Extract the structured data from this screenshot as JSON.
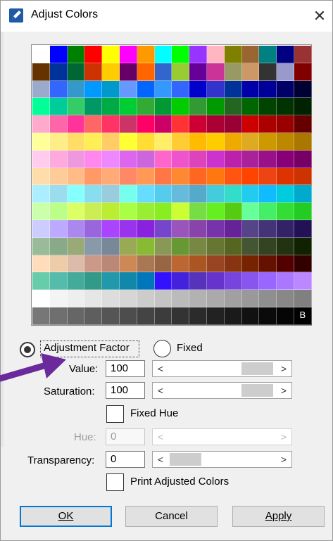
{
  "window": {
    "title": "Adjust Colors",
    "close_glyph": "✕",
    "title_icon": "pencil-icon"
  },
  "palette": {
    "rows": [
      [
        "#ffffff",
        "#0000ff",
        "#008000",
        "#ff0000",
        "#ffff00",
        "#ff00ff",
        "#ff9900",
        "#00ffff",
        "#00ff00",
        "#9933ff",
        "#ffb6c1",
        "#808000",
        "#996633",
        "#008080",
        "#000080",
        "#993333"
      ],
      [
        "#663300",
        "#003399",
        "#006633",
        "#cc3300",
        "#ffcc00",
        "#660066",
        "#ff6600",
        "#3366cc",
        "#99cc33",
        "#660099",
        "#cc3399",
        "#999966",
        "#cc9966",
        "#333333",
        "#9999cc",
        "#800000"
      ],
      [
        "#99aacc",
        "#3366ff",
        "#3399cc",
        "#0099ff",
        "#0099cc",
        "#6699ff",
        "#0066ff",
        "#3399ff",
        "#3366ff",
        "#0000cc",
        "#3333cc",
        "#003399",
        "#0000aa",
        "#000099",
        "#000066",
        "#000033"
      ],
      [
        "#00ff99",
        "#00cc99",
        "#33cc66",
        "#009966",
        "#00aa44",
        "#00cc33",
        "#33aa33",
        "#009933",
        "#00cc00",
        "#339933",
        "#009900",
        "#226622",
        "#006600",
        "#004400",
        "#003300",
        "#002200"
      ],
      [
        "#ffaacc",
        "#ff66aa",
        "#ff3399",
        "#ff6666",
        "#ff3366",
        "#cc3366",
        "#ff0066",
        "#cc0066",
        "#ff3333",
        "#cc0033",
        "#aa0033",
        "#990033",
        "#cc0000",
        "#aa0000",
        "#990000",
        "#660000"
      ],
      [
        "#ffff99",
        "#ffee88",
        "#ffdd66",
        "#ffee55",
        "#ffcc66",
        "#ffff33",
        "#ffdd33",
        "#ffee66",
        "#ffcc33",
        "#ffbb00",
        "#ffcc00",
        "#eeaa00",
        "#ddaa22",
        "#cc9900",
        "#bb8800",
        "#aa7700"
      ],
      [
        "#ffccee",
        "#ffaadd",
        "#ee99dd",
        "#ff88ee",
        "#ee88ff",
        "#dd66ee",
        "#cc66dd",
        "#ff66cc",
        "#ee55cc",
        "#dd44bb",
        "#cc33cc",
        "#bb22aa",
        "#aa2299",
        "#991188",
        "#880077",
        "#770066"
      ],
      [
        "#ffddaa",
        "#ffcc99",
        "#ffbb88",
        "#ff9966",
        "#ffaa77",
        "#ff8866",
        "#ff9955",
        "#ff7744",
        "#ff8833",
        "#ff6622",
        "#ff7711",
        "#ff5511",
        "#ff4400",
        "#ee4411",
        "#dd3300",
        "#cc3300"
      ],
      [
        "#aaeeff",
        "#99ddee",
        "#88ffff",
        "#88ddee",
        "#99ccdd",
        "#77ffee",
        "#66ddff",
        "#55ccee",
        "#66bbdd",
        "#55aacc",
        "#44ccdd",
        "#33ddcc",
        "#22ccee",
        "#11bbff",
        "#00ccdd",
        "#00aacc"
      ],
      [
        "#ccffaa",
        "#bbff88",
        "#ddff66",
        "#ccee55",
        "#bbee33",
        "#aaff44",
        "#99ee33",
        "#88ee22",
        "#ccff33",
        "#77dd44",
        "#66ee22",
        "#55cc11",
        "#66ff99",
        "#44ee66",
        "#33dd33",
        "#22cc22"
      ],
      [
        "#ccccff",
        "#bbaaff",
        "#aa88ee",
        "#9966dd",
        "#aa44ff",
        "#9933ee",
        "#8822dd",
        "#7744cc",
        "#9955bb",
        "#8844aa",
        "#7733aa",
        "#662299",
        "#554488",
        "#443377",
        "#332266",
        "#221155"
      ],
      [
        "#99bb99",
        "#88aa88",
        "#99aa77",
        "#8899aa",
        "#778899",
        "#99aa55",
        "#88bb33",
        "#889955",
        "#669933",
        "#778844",
        "#667733",
        "#556622",
        "#445533",
        "#334422",
        "#223311",
        "#112200"
      ],
      [
        "#ffddbb",
        "#eeccaa",
        "#ddbbaa",
        "#cc9988",
        "#bb8877",
        "#cc8855",
        "#aa7755",
        "#996644",
        "#bb6633",
        "#aa5522",
        "#994422",
        "#883311",
        "#772200",
        "#661100",
        "#550000",
        "#330000"
      ],
      [
        "#66ccaa",
        "#55bbaa",
        "#44aa99",
        "#339988",
        "#2299aa",
        "#1188aa",
        "#0077bb",
        "#3311ff",
        "#4422dd",
        "#5533bb",
        "#6633cc",
        "#7744dd",
        "#8855ee",
        "#9966ff",
        "#aa77ff",
        "#bb88ff"
      ],
      [
        "#ffffff",
        "#f4f4f4",
        "#eeeeee",
        "#e6e6e6",
        "#dddddd",
        "#d6d6d6",
        "#cccccc",
        "#c4c4c4",
        "#bbbbbb",
        "#b2b2b2",
        "#aaaaaa",
        "#a0a0a0",
        "#999999",
        "#8f8f8f",
        "#888888",
        "#808080"
      ],
      [
        "#777777",
        "#6f6f6f",
        "#666666",
        "#5e5e5e",
        "#555555",
        "#4d4d4d",
        "#444444",
        "#3c3c3c",
        "#333333",
        "#2b2b2b",
        "#222222",
        "#1a1a1a",
        "#111111",
        "#0a0a0a",
        "#050505",
        "#000000"
      ]
    ],
    "background_marker": "B"
  },
  "mode": {
    "adjustment_factor_label": "Adjustment Factor",
    "fixed_label": "Fixed",
    "selected": "adjustment_factor"
  },
  "fields": {
    "value_label": "Value:",
    "value": "100",
    "saturation_label": "Saturation:",
    "saturation": "100",
    "fixed_hue_label": "Fixed Hue",
    "fixed_hue_checked": false,
    "hue_label": "Hue:",
    "hue": "0",
    "transparency_label": "Transparency:",
    "transparency": "0",
    "print_adjusted_label": "Print Adjusted Colors",
    "print_adjusted_checked": false
  },
  "scrollbars": {
    "left_glyph": "<",
    "right_glyph": ">",
    "value_level": 0.5,
    "saturation_level": 0.5,
    "transparency_level": 0.0
  },
  "buttons": {
    "ok": "OK",
    "cancel": "Cancel",
    "apply": "Apply"
  },
  "colors": {
    "default_button_border": "#0078d7",
    "annotation_arrow": "#6a2a9c"
  }
}
